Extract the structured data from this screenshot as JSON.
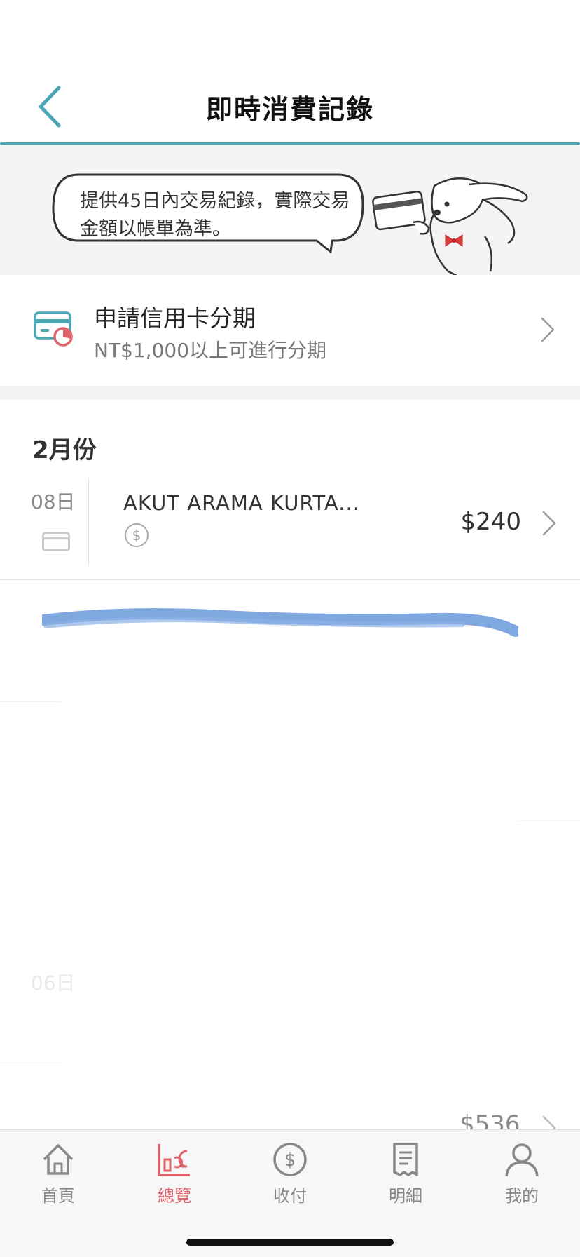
{
  "header": {
    "title": "即時消費記錄"
  },
  "notice": {
    "text": "提供45日內交易紀錄，實際交易金額以帳單為準。"
  },
  "installment": {
    "title": "申請信用卡分期",
    "subtitle": "NT$1,000以上可進行分期"
  },
  "month_label": "2月份",
  "transactions": [
    {
      "day": "08日",
      "merchant": "AKUT ARAMA KURTA...",
      "amount": "$240"
    },
    {
      "day": "06日",
      "amount": "$536"
    }
  ],
  "tabs": [
    {
      "label": "首頁",
      "icon": "home-icon"
    },
    {
      "label": "總覽",
      "icon": "overview-chart-icon",
      "active": true
    },
    {
      "label": "收付",
      "icon": "dollar-coin-icon"
    },
    {
      "label": "明細",
      "icon": "receipt-icon"
    },
    {
      "label": "我的",
      "icon": "user-icon"
    }
  ],
  "colors": {
    "accent": "#4aa7b3",
    "active_tab": "#e0626b",
    "redaction_stroke": "#7fa7e0"
  }
}
